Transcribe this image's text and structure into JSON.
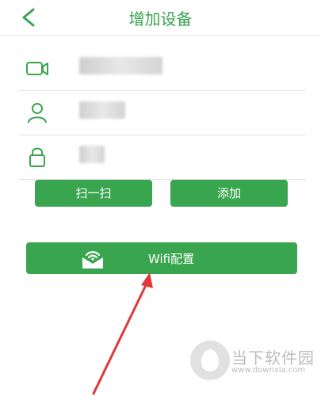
{
  "header": {
    "title": "增加设备",
    "back_icon": "chevron-left-icon"
  },
  "fields": [
    {
      "icon": "camera-icon",
      "value_blurred": true
    },
    {
      "icon": "user-icon",
      "value_blurred": true
    },
    {
      "icon": "lock-icon",
      "value_blurred": true
    }
  ],
  "buttons": {
    "scan_label": "扫一扫",
    "add_label": "添加",
    "wifi_label": "Wifi配置",
    "wifi_icon": "wifi-envelope-icon"
  },
  "watermark": {
    "name": "当下软件园",
    "url": "www.downxia.com"
  },
  "colors": {
    "accent": "#3aa54f",
    "arrow": "#e0383b"
  }
}
